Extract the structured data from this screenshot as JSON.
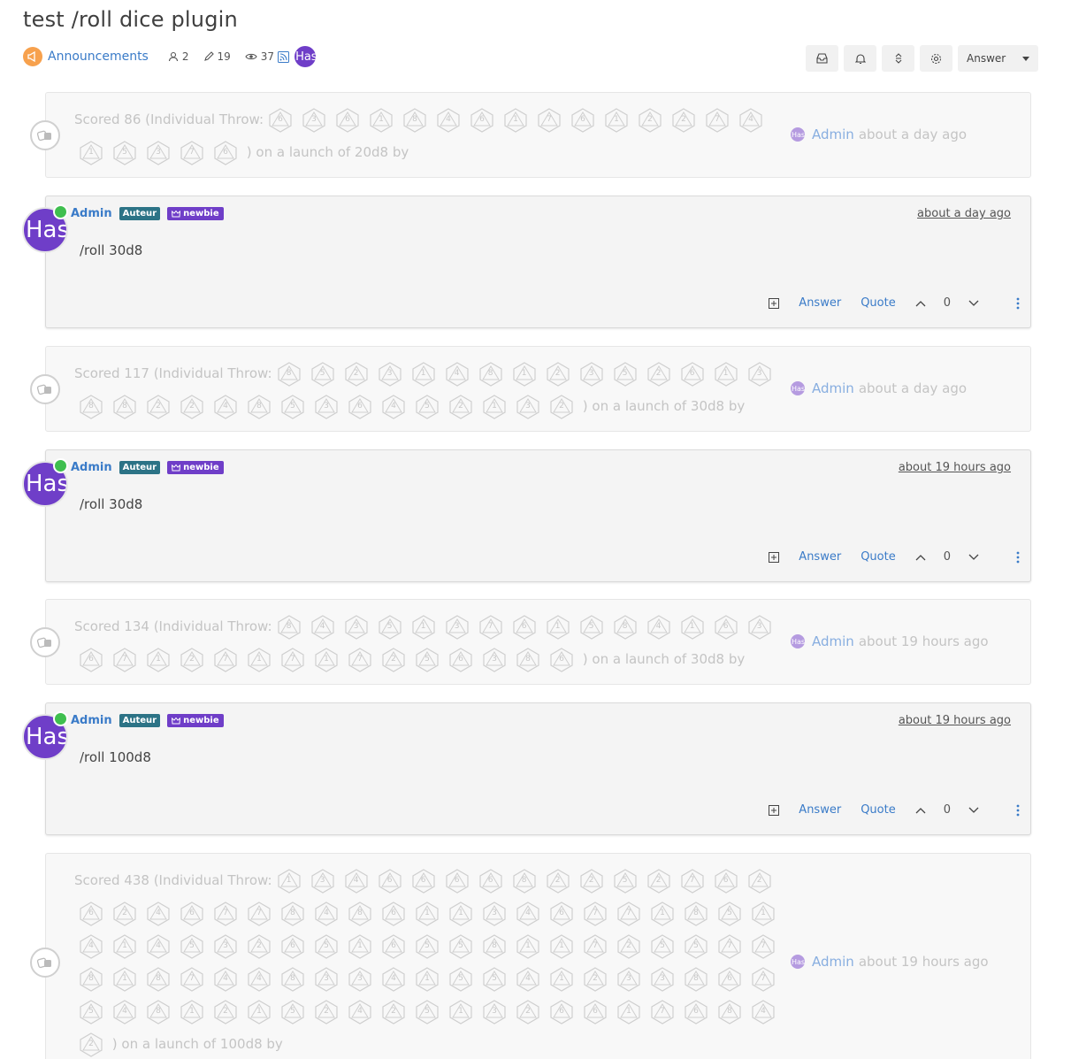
{
  "topic": {
    "title": "test /roll dice plugin",
    "category": "Announcements",
    "posters": "2",
    "posts": "19",
    "views": "37",
    "avatar_text": "Has"
  },
  "toolbar": {
    "answer_label": "Answer"
  },
  "events": [
    {
      "prefix": "Scored 86 (Individual Throw:",
      "dice": [
        6,
        3,
        6,
        1,
        8,
        4,
        6,
        1,
        7,
        6,
        1,
        2,
        2,
        7,
        4,
        1,
        5,
        3,
        7,
        6
      ],
      "suffix": ") on a launch of 20d8 by",
      "author": "Admin",
      "time": "about a day ago",
      "avatar_text": "Has"
    },
    {
      "prefix": "Scored 117 (Individual Throw:",
      "dice": [
        8,
        5,
        2,
        3,
        1,
        4,
        8,
        1,
        2,
        3,
        5,
        2,
        6,
        1,
        3,
        8,
        8,
        2,
        2,
        4,
        8,
        5,
        3,
        6,
        4,
        5,
        2,
        1,
        3,
        2
      ],
      "suffix": ") on a launch of 30d8 by",
      "author": "Admin",
      "time": "about a day ago",
      "avatar_text": "Has"
    },
    {
      "prefix": "Scored 134 (Individual Throw:",
      "dice": [
        8,
        4,
        3,
        5,
        1,
        3,
        7,
        6,
        1,
        5,
        8,
        4,
        1,
        6,
        3,
        6,
        7,
        1,
        2,
        7,
        1,
        7,
        1,
        7,
        2,
        5,
        6,
        3,
        8,
        6
      ],
      "suffix": ") on a launch of 30d8 by",
      "author": "Admin",
      "time": "about 19 hours ago",
      "avatar_text": "Has"
    },
    {
      "prefix": "Scored 438 (Individual Throw:",
      "dice": [
        1,
        3,
        4,
        6,
        6,
        6,
        6,
        8,
        2,
        2,
        5,
        2,
        7,
        6,
        2,
        6,
        2,
        4,
        6,
        7,
        7,
        8,
        4,
        8,
        6,
        1,
        1,
        3,
        4,
        6,
        7,
        7,
        1,
        8,
        5,
        1,
        4,
        1,
        4,
        5,
        3,
        2,
        6,
        5,
        1,
        6,
        5,
        5,
        8,
        1,
        1,
        7,
        2,
        5,
        5,
        7,
        7,
        8,
        1,
        8,
        7,
        4,
        4,
        8,
        3,
        3,
        4,
        1,
        5,
        5,
        4,
        1,
        2,
        3,
        3,
        8,
        6,
        7,
        5,
        4,
        8,
        1,
        2,
        1,
        5,
        2,
        4,
        2,
        5,
        1,
        3,
        2,
        6,
        6,
        1,
        7,
        6,
        8,
        4,
        2
      ],
      "suffix": ") on a launch of 100d8 by",
      "author": "Admin",
      "time": "about 19 hours ago",
      "avatar_text": "Has"
    }
  ],
  "posts": [
    {
      "author": "Admin",
      "badge": "Auteur",
      "badge2": "newbie",
      "time": "about a day ago",
      "content": "/roll 30d8",
      "answer": "Answer",
      "quote": "Quote",
      "votes": "0",
      "avatar_text": "Has"
    },
    {
      "author": "Admin",
      "badge": "Auteur",
      "badge2": "newbie",
      "time": "about 19 hours ago",
      "content": "/roll 30d8",
      "answer": "Answer",
      "quote": "Quote",
      "votes": "0",
      "avatar_text": "Has"
    },
    {
      "author": "Admin",
      "badge": "Auteur",
      "badge2": "newbie",
      "time": "about 19 hours ago",
      "content": "/roll 100d8",
      "answer": "Answer",
      "quote": "Quote",
      "votes": "0",
      "avatar_text": "Has"
    }
  ]
}
